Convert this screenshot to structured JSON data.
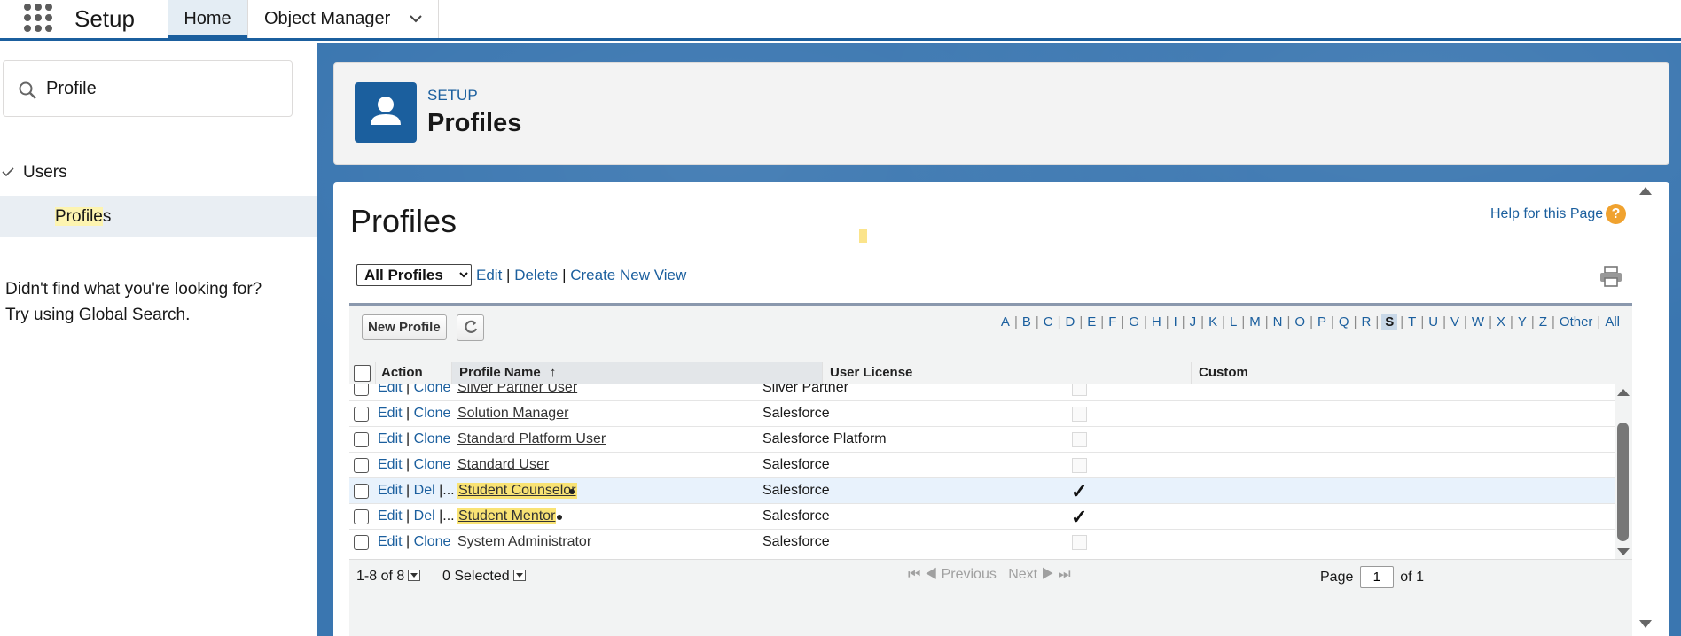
{
  "app": {
    "title": "Setup"
  },
  "tabs": [
    {
      "label": "Home"
    },
    {
      "label": "Object Manager"
    }
  ],
  "sidebar": {
    "search_value": "Profile",
    "tree_parent": "Users",
    "tree_child_match": "Profile",
    "tree_child_rest": "s",
    "not_found_line1": "Didn't find what you're looking for?",
    "not_found_line2": "Try using Global Search."
  },
  "header": {
    "eyebrow": "SETUP",
    "title": "Profiles"
  },
  "content": {
    "heading": "Profiles",
    "help_link": "Help for this Page",
    "help_icon": "?",
    "view_select": "All Profiles",
    "view_edit": "Edit",
    "view_delete": "Delete",
    "view_create": "Create New View",
    "sep": "|"
  },
  "list": {
    "new_button": "New Profile",
    "alphabet": [
      "A",
      "B",
      "C",
      "D",
      "E",
      "F",
      "G",
      "H",
      "I",
      "J",
      "K",
      "L",
      "M",
      "N",
      "O",
      "P",
      "Q",
      "R",
      "S",
      "T",
      "U",
      "V",
      "W",
      "X",
      "Y",
      "Z",
      "Other",
      "All"
    ],
    "selected_letter": "S",
    "columns": {
      "action": "Action",
      "profile_name": "Profile Name",
      "sort_arrow": "↑",
      "user_license": "User License",
      "custom": "Custom"
    },
    "rows": [
      {
        "a1": "Edit",
        "a2": "Clone",
        "name": "Silver Partner User",
        "license": "Silver Partner",
        "custom": false
      },
      {
        "a1": "Edit",
        "a2": "Clone",
        "name": "Solution Manager",
        "license": "Salesforce",
        "custom": false
      },
      {
        "a1": "Edit",
        "a2": "Clone",
        "name": "Standard Platform User",
        "license": "Salesforce Platform",
        "custom": false
      },
      {
        "a1": "Edit",
        "a2": "Clone",
        "name": "Standard User",
        "license": "Salesforce",
        "custom": false
      },
      {
        "a1": "Edit",
        "a2": "Del",
        "a3": "|...",
        "name": "Student Counselor",
        "license": "Salesforce",
        "custom": true
      },
      {
        "a1": "Edit",
        "a2": "Del",
        "a3": "|...",
        "name": "Student Mentor",
        "license": "Salesforce",
        "custom": true
      },
      {
        "a1": "Edit",
        "a2": "Clone",
        "name": "System Administrator",
        "license": "Salesforce",
        "custom": false
      }
    ],
    "check_glyph": "✓",
    "footer": {
      "count": "1-8 of 8",
      "selected": "0 Selected",
      "previous": "Previous",
      "next": "Next",
      "page_label": "Page",
      "page_value": "1",
      "of_label": "of 1"
    }
  },
  "colors": {
    "brand": "#1b5f9e",
    "highlight": "#f9e374",
    "row_highlight": "#e8f2fc"
  }
}
